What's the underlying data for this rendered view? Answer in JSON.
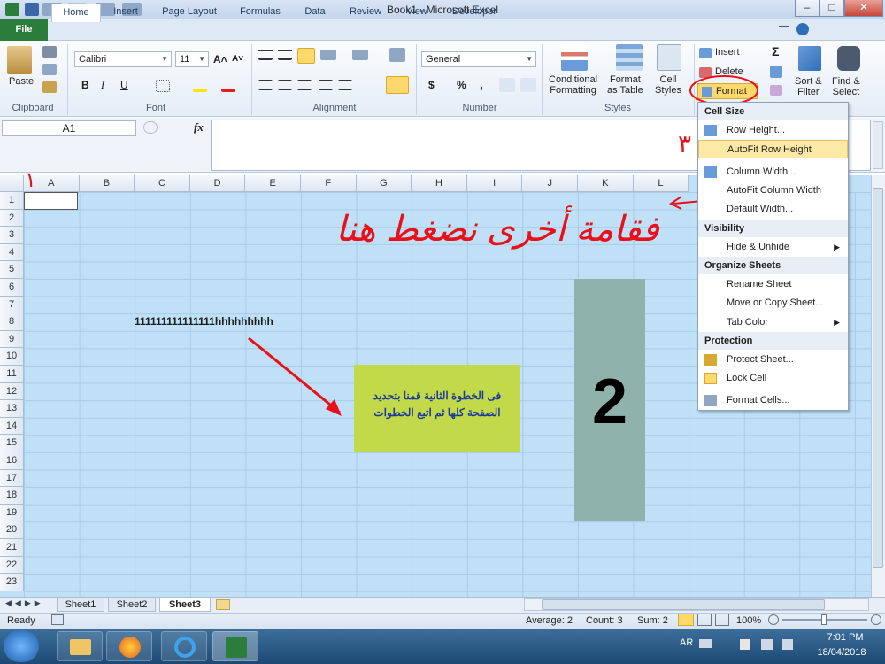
{
  "window": {
    "title": "Book1 - Microsoft Excel"
  },
  "titlebar_buttons": [
    "–",
    "□",
    "✕"
  ],
  "tabs": [
    "File",
    "Home",
    "Insert",
    "Page Layout",
    "Formulas",
    "Data",
    "Review",
    "View",
    "Developer"
  ],
  "clipboard": {
    "paste": "Paste",
    "label": "Clipboard"
  },
  "font": {
    "name": "Calibri",
    "size": "11",
    "label": "Font",
    "bold": "B",
    "italic": "I",
    "underline": "U",
    "grow": "A˄",
    "shrink": "A˅"
  },
  "alignment": {
    "label": "Alignment"
  },
  "number": {
    "format": "General",
    "label": "Number",
    "currency": "$",
    "percent": "%",
    "comma": ","
  },
  "styles": {
    "conditional": "Conditional\nFormatting",
    "format_table": "Format\nas Table",
    "cell_styles": "Cell\nStyles",
    "label": "Styles"
  },
  "cells": {
    "insert": "Insert",
    "delete": "Delete",
    "format": "Format"
  },
  "editing": {
    "sum": "Σ",
    "sort": "Sort &\nFilter",
    "find": "Find &\nSelect"
  },
  "namebox": "A1",
  "fx": "fx",
  "columns": [
    "A",
    "B",
    "C",
    "D",
    "E",
    "F",
    "G",
    "H",
    "I",
    "J",
    "K",
    "L"
  ],
  "rows": [
    "1",
    "2",
    "3",
    "4",
    "5",
    "6",
    "7",
    "8",
    "9",
    "10",
    "11",
    "12",
    "13",
    "14",
    "15",
    "16",
    "17",
    "18",
    "19",
    "20",
    "21",
    "22",
    "23"
  ],
  "cell_text": "111111111111111hhhhhhhhh",
  "callout_text": "فى الخطوة الثانية قمنا بتحديد الصفحة كلها ثم اتبع الخطوات",
  "step_number": "2",
  "annotations": {
    "step1": "١",
    "step3": "٣",
    "handwritten": "فقامة أخرى نضغط هنا"
  },
  "menu": {
    "cell_size": "Cell Size",
    "row_height": "Row Height...",
    "autofit_row": "AutoFit Row Height",
    "col_width": "Column Width...",
    "autofit_col": "AutoFit Column Width",
    "default_width": "Default Width...",
    "visibility": "Visibility",
    "hide_unhide": "Hide & Unhide",
    "organize": "Organize Sheets",
    "rename": "Rename Sheet",
    "move_copy": "Move or Copy Sheet...",
    "tab_color": "Tab Color",
    "protection": "Protection",
    "protect": "Protect Sheet...",
    "lock": "Lock Cell",
    "format_cells": "Format Cells..."
  },
  "sheets": [
    "Sheet1",
    "Sheet2",
    "Sheet3"
  ],
  "status": {
    "ready": "Ready",
    "average": "Average: 2",
    "count": "Count: 3",
    "sum": "Sum: 2",
    "zoom": "100%"
  },
  "taskbar": {
    "lang": "AR",
    "time": "7:01 PM",
    "date": "18/04/2018"
  },
  "colors": {
    "grid_bg": "#bfe0f7",
    "callout": "#c2d94a",
    "tall_box": "#8fb3aa",
    "annotation": "#e8101a",
    "file_tab": "#2a7d3a"
  }
}
